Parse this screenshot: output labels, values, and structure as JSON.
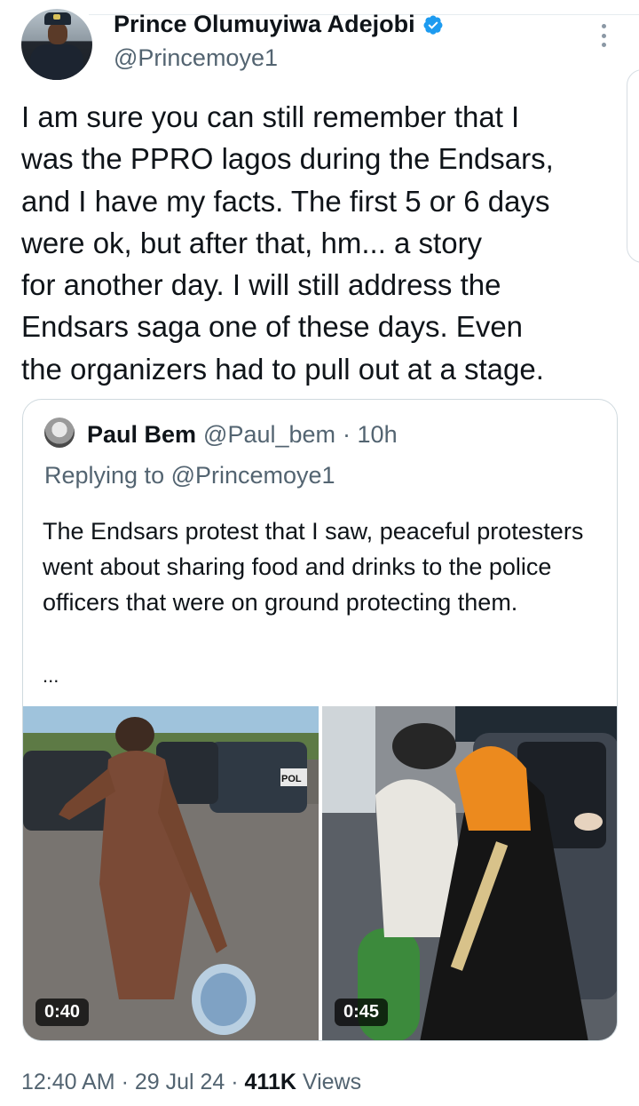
{
  "author": {
    "name": "Prince Olumuyiwa Adejobi",
    "handle": "@Princemoye1"
  },
  "tweet": {
    "text": "I am sure you can still remember that I\nwas the PPRO lagos during the Endsars,\nand I have my facts. The first 5 or 6 days\nwere ok, but after that, hm... a story\nfor another day. I will still address the\nEndsars saga one of these days. Even\nthe organizers had to pull out at a stage."
  },
  "quote": {
    "name": "Paul Bem",
    "handle": "@Paul_bem",
    "time": "· 10h",
    "replying_to": "Replying to @Princemoye1",
    "text": "The Endsars protest that I saw, peaceful protesters went about sharing food and drinks to the  police officers that were on ground protecting them.",
    "ellipsis": "...",
    "media": [
      {
        "duration": "0:40",
        "scene": "man in brown outfit carrying drinks beside police vehicles",
        "sign": "POL"
      },
      {
        "duration": "0:45",
        "scene": "protesters handing items to officers in a police truck"
      }
    ]
  },
  "meta": {
    "timestamp": "12:40 AM · 29 Jul 24 · ",
    "views_count": "411K",
    "views_label": " Views"
  },
  "colors": {
    "verified": "#1d9bf0",
    "secondary_text": "#536471",
    "border": "#cfd9de"
  }
}
